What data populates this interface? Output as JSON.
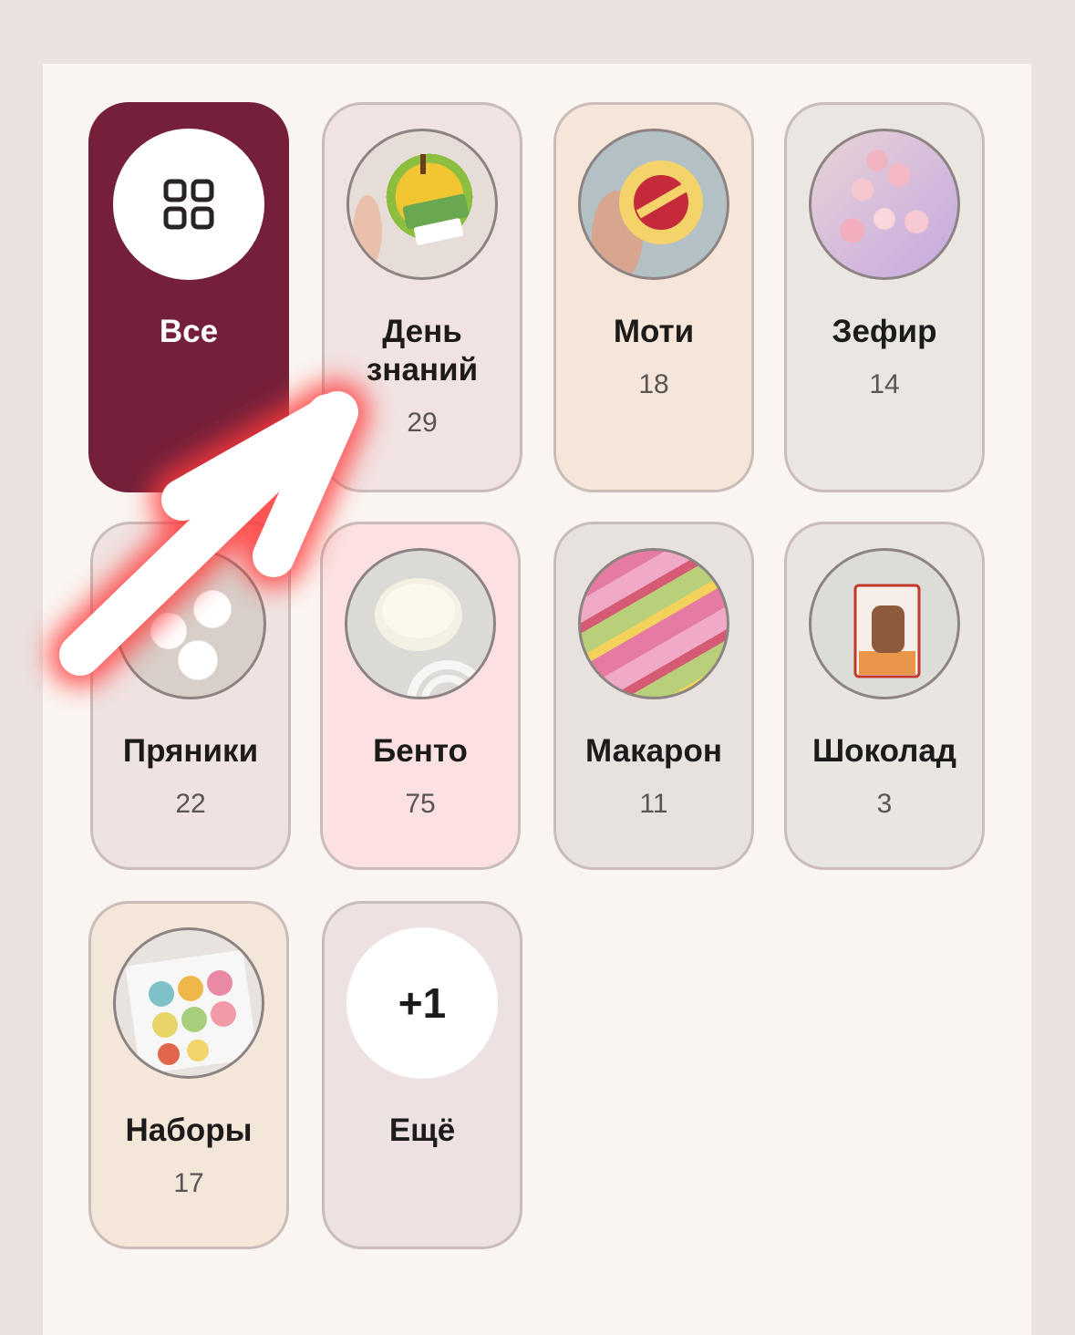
{
  "categories": [
    {
      "label": "Все",
      "count": "",
      "icon": "grid-icon",
      "bg": "#74203a"
    },
    {
      "label": "День знаний",
      "count": "29",
      "icon": "apple-cookie-photo",
      "bg": "#f1e3e2"
    },
    {
      "label": "Моти",
      "count": "18",
      "icon": "mochi-photo",
      "bg": "#f6e6da"
    },
    {
      "label": "Зефир",
      "count": "14",
      "icon": "zephyr-bouquet-photo",
      "bg": "#eae6e2"
    },
    {
      "label": "Пряники",
      "count": "22",
      "icon": "gingerbread-photo",
      "bg": "#efe3e1"
    },
    {
      "label": "Бенто",
      "count": "75",
      "icon": "bento-cake-photo",
      "bg": "#fbe1e1"
    },
    {
      "label": "Макарон",
      "count": "11",
      "icon": "macarons-photo",
      "bg": "#e8e2df"
    },
    {
      "label": "Шоколад",
      "count": "3",
      "icon": "chocolate-photo",
      "bg": "#e9e5e1"
    },
    {
      "label": "Наборы",
      "count": "17",
      "icon": "gift-set-photo",
      "bg": "#f5e6da"
    },
    {
      "label": "Ещё",
      "count": "",
      "more": "+1",
      "icon": "more-badge",
      "bg": "#ede2e1"
    }
  ],
  "colors": {
    "page_bg": "#ebe1df",
    "panel_bg": "#faf5f1",
    "accent": "#74203a",
    "arrow_glow": "#ff3b3b"
  }
}
